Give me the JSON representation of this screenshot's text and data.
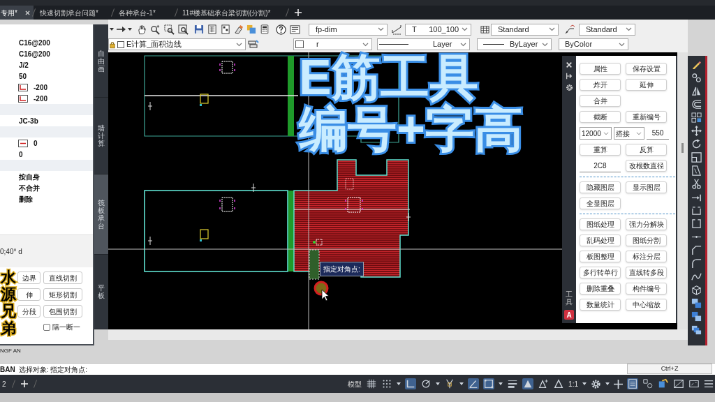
{
  "tabs": [
    {
      "label": "专用*",
      "selected": true
    },
    {
      "label": "快速切割承台问题*",
      "selected": false
    },
    {
      "label": "各种承台-1*",
      "selected": false
    },
    {
      "label": "11#楼基础承台梁切割(分割)*",
      "selected": false
    }
  ],
  "toolbar": {
    "style_fields": [
      {
        "parts": [
          "fp-dim"
        ]
      },
      {
        "parts": [
          "T",
          "100_100"
        ]
      },
      {
        "parts": [
          "Standard"
        ]
      },
      {
        "parts": [
          "Standard"
        ]
      }
    ],
    "layer_field": "E计算_面积边线",
    "property_fields": [
      {
        "kind": "color",
        "value": "r"
      },
      {
        "kind": "linetype",
        "value": "Layer"
      },
      {
        "kind": "lineweight",
        "value": "ByLayer"
      },
      {
        "kind": "plain",
        "value": "ByColor"
      }
    ]
  },
  "overlay_title": [
    "E筋工具",
    "编号+字高"
  ],
  "properties_panel": {
    "rows": [
      {
        "kind": "text",
        "value": "C16@200"
      },
      {
        "kind": "text",
        "value": "C16@200"
      },
      {
        "kind": "text",
        "value": "J/2"
      },
      {
        "kind": "text",
        "value": "50"
      },
      {
        "kind": "corner",
        "value": "-200"
      },
      {
        "kind": "corner",
        "value": "-200"
      },
      {
        "kind": "header"
      },
      {
        "kind": "text",
        "value": "JC-3b"
      },
      {
        "kind": "header"
      },
      {
        "kind": "dash",
        "value": "0"
      },
      {
        "kind": "text",
        "value": "0"
      },
      {
        "kind": "header"
      },
      {
        "kind": "text",
        "value": "按自身"
      },
      {
        "kind": "text",
        "value": "不合并"
      },
      {
        "kind": "text",
        "value": "删除"
      }
    ],
    "status_text": "0;40° d",
    "buttons": [
      [
        "边界",
        "直线切割"
      ],
      [
        "伸",
        "矩形切割"
      ],
      [
        "分段",
        "包围切割"
      ]
    ],
    "checkbox": {
      "label": "隔一断一",
      "checked": false
    }
  },
  "side_tabs": [
    {
      "label": "自由画",
      "selected": false
    },
    {
      "label": "墙计算",
      "selected": false
    },
    {
      "label": "筏板承台",
      "selected": true
    },
    {
      "label": "平板",
      "selected": false
    }
  ],
  "signature": {
    "text": "水源兄弟",
    "caption": "NGF AN"
  },
  "canvas": {
    "tooltip": "指定对角点:"
  },
  "tool_palette": {
    "title": "工具",
    "badge": "A",
    "rows": [
      {
        "kind": "buttons",
        "items": [
          "属性",
          "保存设置"
        ]
      },
      {
        "kind": "buttons",
        "items": [
          "炸开",
          "延伸"
        ]
      },
      {
        "kind": "buttons",
        "items": [
          "合并"
        ]
      },
      {
        "kind": "buttons",
        "items": [
          "截断",
          "重新编号"
        ]
      },
      {
        "kind": "inputs",
        "items": [
          {
            "kind": "select",
            "value": "12000"
          },
          {
            "kind": "select",
            "value": "搭接"
          },
          {
            "kind": "field",
            "value": "550"
          }
        ]
      },
      {
        "kind": "buttons",
        "items": [
          "重算",
          "反算"
        ]
      },
      {
        "kind": "inputs",
        "items": [
          {
            "kind": "field",
            "value": "2C8"
          },
          {
            "kind": "button",
            "value": "改根数直径"
          }
        ]
      },
      {
        "kind": "separator"
      },
      {
        "kind": "buttons",
        "items": [
          "隐藏图层",
          "显示图层"
        ]
      },
      {
        "kind": "buttons",
        "items": [
          "全显图层"
        ]
      },
      {
        "kind": "separator"
      },
      {
        "kind": "buttons",
        "items": [
          "图纸处理",
          "强力分解块"
        ]
      },
      {
        "kind": "buttons",
        "items": [
          "乱码处理",
          "图纸分割"
        ]
      },
      {
        "kind": "buttons",
        "items": [
          "板图整理",
          "标注分层"
        ]
      },
      {
        "kind": "buttons",
        "items": [
          "多行转单行",
          "直线转多段"
        ]
      },
      {
        "kind": "buttons",
        "items": [
          "删除重叠",
          "构件编号"
        ]
      },
      {
        "kind": "buttons",
        "items": [
          "数量统计",
          "中心缩放"
        ]
      }
    ]
  },
  "command_line": {
    "prefix": "BAN",
    "prompt": "选择对象: 指定对角点:"
  },
  "status_bar": {
    "layout_tab": "2",
    "model_label": "模型",
    "toggles": [
      {
        "kind": "grid",
        "on": false
      },
      {
        "kind": "snap",
        "on": false
      },
      {
        "kind": "ortho",
        "on": true
      },
      {
        "kind": "polar",
        "on": false
      },
      {
        "kind": "osnap",
        "on": false
      },
      {
        "kind": "angle",
        "on": true
      },
      {
        "kind": "selection",
        "on": true
      },
      {
        "kind": "lineweight",
        "on": false
      },
      {
        "kind": "annotation",
        "on": true
      },
      {
        "kind": "autoscale",
        "on": false
      },
      {
        "kind": "annovis",
        "on": false
      }
    ],
    "scale": "1:1",
    "toggles_right": [
      {
        "kind": "properties",
        "on": true
      },
      {
        "kind": "isolate",
        "on": false
      },
      {
        "kind": "hardware",
        "on": false
      },
      {
        "kind": "clean",
        "on": false
      },
      {
        "kind": "fullscreen",
        "on": false
      }
    ]
  },
  "shortcut_hint": "Ctrl+Z"
}
